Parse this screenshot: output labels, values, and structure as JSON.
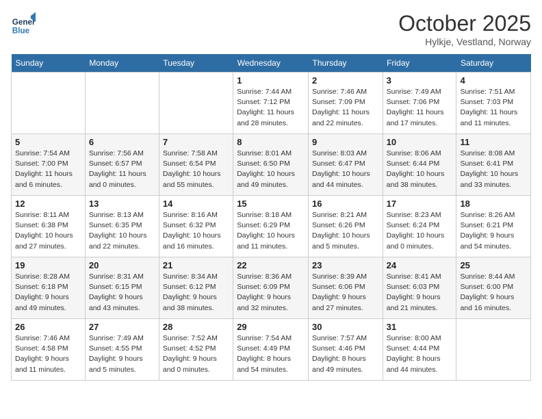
{
  "header": {
    "logo_line1": "General",
    "logo_line2": "Blue",
    "month_title": "October 2025",
    "location": "Hylkje, Vestland, Norway"
  },
  "weekdays": [
    "Sunday",
    "Monday",
    "Tuesday",
    "Wednesday",
    "Thursday",
    "Friday",
    "Saturday"
  ],
  "weeks": [
    [
      {
        "day": "",
        "info": ""
      },
      {
        "day": "",
        "info": ""
      },
      {
        "day": "",
        "info": ""
      },
      {
        "day": "1",
        "info": "Sunrise: 7:44 AM\nSunset: 7:12 PM\nDaylight: 11 hours\nand 28 minutes."
      },
      {
        "day": "2",
        "info": "Sunrise: 7:46 AM\nSunset: 7:09 PM\nDaylight: 11 hours\nand 22 minutes."
      },
      {
        "day": "3",
        "info": "Sunrise: 7:49 AM\nSunset: 7:06 PM\nDaylight: 11 hours\nand 17 minutes."
      },
      {
        "day": "4",
        "info": "Sunrise: 7:51 AM\nSunset: 7:03 PM\nDaylight: 11 hours\nand 11 minutes."
      }
    ],
    [
      {
        "day": "5",
        "info": "Sunrise: 7:54 AM\nSunset: 7:00 PM\nDaylight: 11 hours\nand 6 minutes."
      },
      {
        "day": "6",
        "info": "Sunrise: 7:56 AM\nSunset: 6:57 PM\nDaylight: 11 hours\nand 0 minutes."
      },
      {
        "day": "7",
        "info": "Sunrise: 7:58 AM\nSunset: 6:54 PM\nDaylight: 10 hours\nand 55 minutes."
      },
      {
        "day": "8",
        "info": "Sunrise: 8:01 AM\nSunset: 6:50 PM\nDaylight: 10 hours\nand 49 minutes."
      },
      {
        "day": "9",
        "info": "Sunrise: 8:03 AM\nSunset: 6:47 PM\nDaylight: 10 hours\nand 44 minutes."
      },
      {
        "day": "10",
        "info": "Sunrise: 8:06 AM\nSunset: 6:44 PM\nDaylight: 10 hours\nand 38 minutes."
      },
      {
        "day": "11",
        "info": "Sunrise: 8:08 AM\nSunset: 6:41 PM\nDaylight: 10 hours\nand 33 minutes."
      }
    ],
    [
      {
        "day": "12",
        "info": "Sunrise: 8:11 AM\nSunset: 6:38 PM\nDaylight: 10 hours\nand 27 minutes."
      },
      {
        "day": "13",
        "info": "Sunrise: 8:13 AM\nSunset: 6:35 PM\nDaylight: 10 hours\nand 22 minutes."
      },
      {
        "day": "14",
        "info": "Sunrise: 8:16 AM\nSunset: 6:32 PM\nDaylight: 10 hours\nand 16 minutes."
      },
      {
        "day": "15",
        "info": "Sunrise: 8:18 AM\nSunset: 6:29 PM\nDaylight: 10 hours\nand 11 minutes."
      },
      {
        "day": "16",
        "info": "Sunrise: 8:21 AM\nSunset: 6:26 PM\nDaylight: 10 hours\nand 5 minutes."
      },
      {
        "day": "17",
        "info": "Sunrise: 8:23 AM\nSunset: 6:24 PM\nDaylight: 10 hours\nand 0 minutes."
      },
      {
        "day": "18",
        "info": "Sunrise: 8:26 AM\nSunset: 6:21 PM\nDaylight: 9 hours\nand 54 minutes."
      }
    ],
    [
      {
        "day": "19",
        "info": "Sunrise: 8:28 AM\nSunset: 6:18 PM\nDaylight: 9 hours\nand 49 minutes."
      },
      {
        "day": "20",
        "info": "Sunrise: 8:31 AM\nSunset: 6:15 PM\nDaylight: 9 hours\nand 43 minutes."
      },
      {
        "day": "21",
        "info": "Sunrise: 8:34 AM\nSunset: 6:12 PM\nDaylight: 9 hours\nand 38 minutes."
      },
      {
        "day": "22",
        "info": "Sunrise: 8:36 AM\nSunset: 6:09 PM\nDaylight: 9 hours\nand 32 minutes."
      },
      {
        "day": "23",
        "info": "Sunrise: 8:39 AM\nSunset: 6:06 PM\nDaylight: 9 hours\nand 27 minutes."
      },
      {
        "day": "24",
        "info": "Sunrise: 8:41 AM\nSunset: 6:03 PM\nDaylight: 9 hours\nand 21 minutes."
      },
      {
        "day": "25",
        "info": "Sunrise: 8:44 AM\nSunset: 6:00 PM\nDaylight: 9 hours\nand 16 minutes."
      }
    ],
    [
      {
        "day": "26",
        "info": "Sunrise: 7:46 AM\nSunset: 4:58 PM\nDaylight: 9 hours\nand 11 minutes."
      },
      {
        "day": "27",
        "info": "Sunrise: 7:49 AM\nSunset: 4:55 PM\nDaylight: 9 hours\nand 5 minutes."
      },
      {
        "day": "28",
        "info": "Sunrise: 7:52 AM\nSunset: 4:52 PM\nDaylight: 9 hours\nand 0 minutes."
      },
      {
        "day": "29",
        "info": "Sunrise: 7:54 AM\nSunset: 4:49 PM\nDaylight: 8 hours\nand 54 minutes."
      },
      {
        "day": "30",
        "info": "Sunrise: 7:57 AM\nSunset: 4:46 PM\nDaylight: 8 hours\nand 49 minutes."
      },
      {
        "day": "31",
        "info": "Sunrise: 8:00 AM\nSunset: 4:44 PM\nDaylight: 8 hours\nand 44 minutes."
      },
      {
        "day": "",
        "info": ""
      }
    ]
  ]
}
